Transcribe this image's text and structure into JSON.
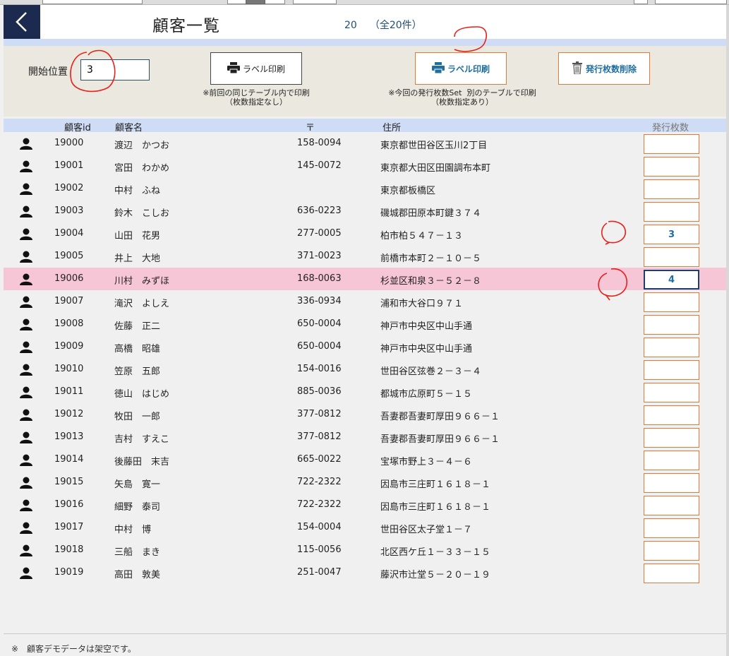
{
  "header": {
    "title": "顧客一覧",
    "count": "20",
    "total": "（全20件）"
  },
  "controls": {
    "start_label": "開始位置",
    "start_value": "3",
    "print_label": "ラベル印刷",
    "print_note": "※前回の同じテーブル内で印刷\n（枚数指定なし）",
    "print2_label": "ラベル印刷",
    "print2_note": "※今回の発行枚数Set  別のテーブルで印刷\n（枚数指定あり）",
    "delete_label": "発行枚数削除"
  },
  "table": {
    "headers": {
      "id": "顧客id",
      "name": "顧客名",
      "zip": "〒",
      "address": "住所",
      "count": "発行枚数"
    },
    "rows": [
      {
        "id": "19000",
        "name": "渡辺　かつお",
        "zip": "158-0094",
        "address": "東京都世田谷区玉川2丁目",
        "count": ""
      },
      {
        "id": "19001",
        "name": "宮田　わかめ",
        "zip": "145-0072",
        "address": "東京都大田区田園調布本町",
        "count": ""
      },
      {
        "id": "19002",
        "name": "中村　ふね",
        "zip": "",
        "address": "東京都板橋区",
        "count": ""
      },
      {
        "id": "19003",
        "name": "鈴木　こしお",
        "zip": "636-0223",
        "address": "磯城郡田原本町鍵３７４",
        "count": ""
      },
      {
        "id": "19004",
        "name": "山田　花男",
        "zip": "277-0005",
        "address": "柏市柏５４７－１３",
        "count": "3"
      },
      {
        "id": "19005",
        "name": "井上　大地",
        "zip": "371-0023",
        "address": "前橋市本町２－１０－５",
        "count": ""
      },
      {
        "id": "19006",
        "name": "川村　みずほ",
        "zip": "168-0063",
        "address": "杉並区和泉３－５２－８",
        "count": "4"
      },
      {
        "id": "19007",
        "name": "滝沢　よしえ",
        "zip": "336-0934",
        "address": "浦和市大谷口９７１",
        "count": ""
      },
      {
        "id": "19008",
        "name": "佐藤　正二",
        "zip": "650-0004",
        "address": "神戸市中央区中山手通",
        "count": ""
      },
      {
        "id": "19009",
        "name": "高橋　昭雄",
        "zip": "650-0004",
        "address": "神戸市中央区中山手通",
        "count": ""
      },
      {
        "id": "19010",
        "name": "笠原　五郎",
        "zip": "154-0016",
        "address": "世田谷区弦巻２－３－４",
        "count": ""
      },
      {
        "id": "19011",
        "name": "徳山　はじめ",
        "zip": "885-0036",
        "address": "都城市広原町５－１５",
        "count": ""
      },
      {
        "id": "19012",
        "name": "牧田　一郎",
        "zip": "377-0812",
        "address": "吾妻郡吾妻町厚田９６６－１",
        "count": ""
      },
      {
        "id": "19013",
        "name": "吉村　すえこ",
        "zip": "377-0812",
        "address": "吾妻郡吾妻町厚田９６６－１",
        "count": ""
      },
      {
        "id": "19014",
        "name": "後藤田　末吉",
        "zip": "665-0022",
        "address": "宝塚市野上３－４－６",
        "count": ""
      },
      {
        "id": "19015",
        "name": "矢島　寛一",
        "zip": "722-2322",
        "address": "因島市三庄町１６１８－１",
        "count": ""
      },
      {
        "id": "19016",
        "name": "細野　泰司",
        "zip": "722-2322",
        "address": "因島市三庄町１６１８－１",
        "count": ""
      },
      {
        "id": "19017",
        "name": "中村　博",
        "zip": "154-0004",
        "address": "世田谷区太子堂１－７",
        "count": ""
      },
      {
        "id": "19018",
        "name": "三船　まき",
        "zip": "115-0056",
        "address": "北区西ケ丘１－３３－１５",
        "count": ""
      },
      {
        "id": "19019",
        "name": "高田　敦美",
        "zip": "251-0047",
        "address": "藤沢市辻堂５－２０－１９",
        "count": ""
      }
    ],
    "selected_index": 6
  },
  "footer": {
    "note": "※　顧客デモデータは架空です。"
  },
  "colors": {
    "header_bg": "#1b2a4e",
    "band": "#cfdcf5",
    "panel": "#ebe9df",
    "accent_orange": "#e07a3a",
    "accent_blue": "#1f6e9e",
    "selected_row": "#f7c6d6",
    "annotation": "#e8201a"
  },
  "icons": {
    "back": "chevron-left-icon",
    "print": "printer-icon",
    "delete": "trash-icon",
    "person": "person-icon"
  }
}
